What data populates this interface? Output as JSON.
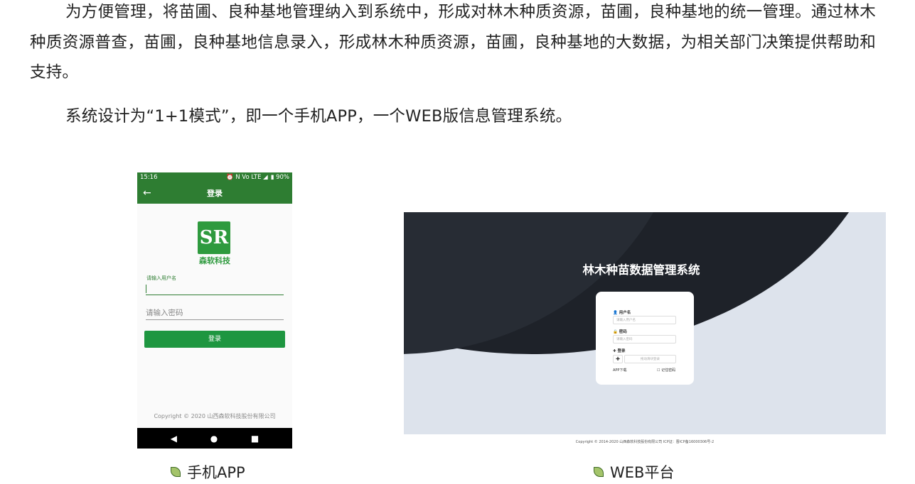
{
  "paragraphs": {
    "p1": "为方便管理，将苗圃、良种基地管理纳入到系统中，形成对林木种质资源，苗圃，良种基地的统一管理。通过林木种质资源普查，苗圃，良种基地信息录入，形成林木种质资源，苗圃，良种基地的大数据，为相关部门决策提供帮助和支持。",
    "p2": "系统设计为“1+1模式”，即一个手机APP，一个WEB版信息管理系统。"
  },
  "phone": {
    "status_time": "15:16",
    "status_icons": "⏰ N Vo LTE ◢",
    "battery": "▮ 90%",
    "back_icon": "←",
    "title": "登录",
    "logo_text": "SR",
    "logo_name": "森软科技",
    "username_label": "请输入用户名",
    "password_placeholder": "请输入密码",
    "login_button": "登录",
    "copyright": "Copyright © 2020 山西森软科技股份有限公司",
    "nav_back": "◀",
    "nav_home": "●",
    "nav_recent": "■"
  },
  "web": {
    "title": "林木种苗数据管理系统",
    "username_label": "用户名",
    "username_placeholder": "请输入用户名",
    "password_label": "密码",
    "password_placeholder": "请输入密码",
    "login_label": "登录",
    "captcha_symbol": "✚",
    "captcha_placeholder": "拖动滑块登录",
    "app_download": "APP下载",
    "remember": "记住密码",
    "copyright": "Copyright © 2014-2020 山西森软科技股份有限公司   ICP证：晋ICP备16000306号-2"
  },
  "captions": {
    "phone": "手机APP",
    "web": "WEB平台"
  },
  "colors": {
    "phone_green": "#2e7d32",
    "button_green": "#1e9640",
    "web_dark": "#1e2229",
    "web_light": "#dde3ec"
  }
}
